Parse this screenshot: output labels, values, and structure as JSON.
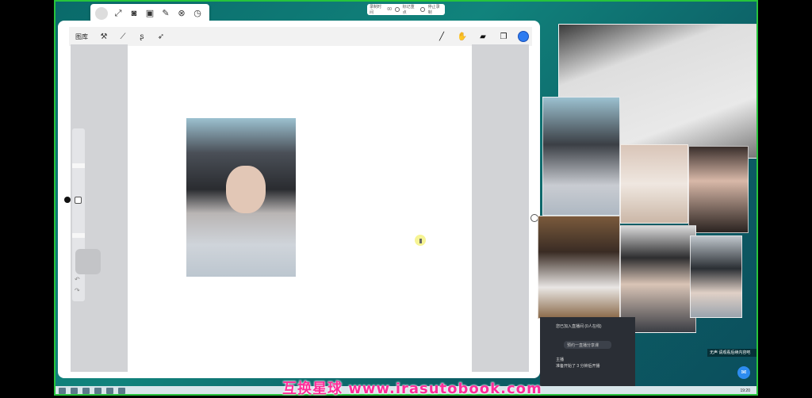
{
  "procreate": {
    "gallery_label": "图库",
    "tools_left": [
      "wrench-icon",
      "magic-wand-icon",
      "selection-icon",
      "move-arrow-icon"
    ],
    "tools_right": [
      "brush-icon",
      "smudge-icon",
      "eraser-icon",
      "layers-icon"
    ],
    "active_color": "#2d7bf0"
  },
  "recording_bar": {
    "label": "录制时间",
    "value": "00",
    "option_1": "标记重点",
    "option_2": "停止录制"
  },
  "chat": {
    "line1": "您已加入直播间 (0人在线)",
    "bubble": "预约一直播分享课",
    "line2": "主播",
    "line3": "准备开始了 3 分钟后开播"
  },
  "notice": "无声 请观看后续内容吧",
  "taskbar": {
    "clock": "19:20"
  },
  "watermark": "互换星球 www.irasutobook.com"
}
